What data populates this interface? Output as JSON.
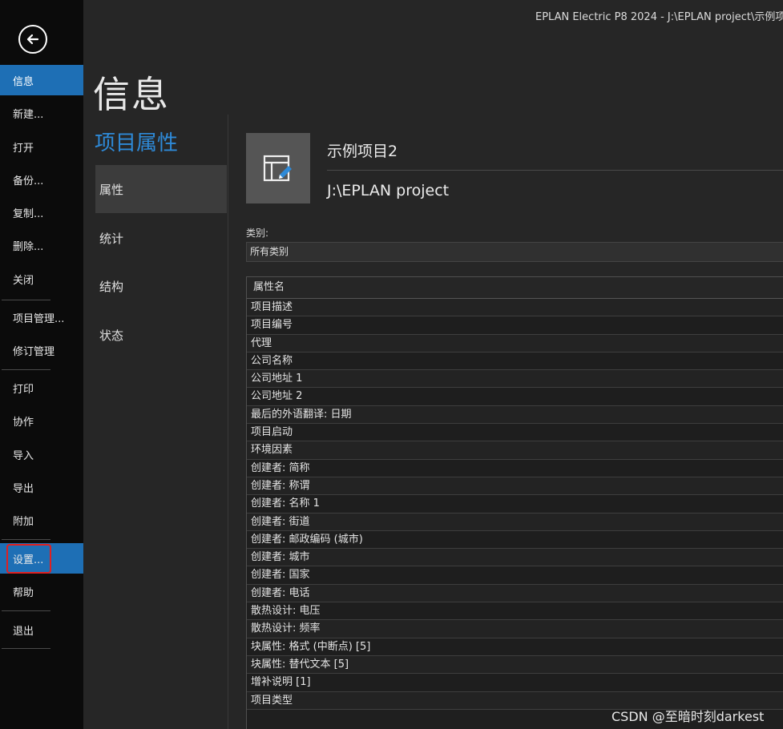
{
  "window": {
    "title": "EPLAN Electric P8 2024 - J:\\EPLAN project\\示例项"
  },
  "nav": {
    "back_icon": "arrow-left-circle-icon",
    "items": [
      {
        "label": "信息"
      },
      {
        "label": "新建..."
      },
      {
        "label": "打开"
      },
      {
        "label": "备份..."
      },
      {
        "label": "复制..."
      },
      {
        "label": "删除..."
      },
      {
        "label": "关闭"
      },
      {
        "label": "项目管理..."
      },
      {
        "label": "修订管理"
      },
      {
        "label": "打印"
      },
      {
        "label": "协作"
      },
      {
        "label": "导入"
      },
      {
        "label": "导出"
      },
      {
        "label": "附加"
      },
      {
        "label": "设置..."
      },
      {
        "label": "帮助"
      },
      {
        "label": "退出"
      }
    ]
  },
  "page": {
    "title": "信息"
  },
  "subnav": {
    "title": "项目属性",
    "items": [
      {
        "label": "属性"
      },
      {
        "label": "统计"
      },
      {
        "label": "结构"
      },
      {
        "label": "状态"
      }
    ]
  },
  "project": {
    "icon": "project-edit-icon",
    "name": "示例项目2",
    "path": "J:\\EPLAN project"
  },
  "category": {
    "label": "类别:",
    "value": "所有类别"
  },
  "properties": {
    "header": "属性名",
    "rows": [
      "项目描述",
      "项目编号",
      "代理",
      "公司名称",
      "公司地址 1",
      "公司地址 2",
      "最后的外语翻译: 日期",
      "项目启动",
      "环境因素",
      "创建者: 简称",
      "创建者: 称谓",
      "创建者: 名称 1",
      "创建者: 街道",
      "创建者: 邮政编码 (城市)",
      "创建者: 城市",
      "创建者: 国家",
      "创建者: 电话",
      "散热设计: 电压",
      "散热设计: 频率",
      "块属性: 格式 (中断点) [5]",
      "块属性: 替代文本 [5]",
      "增补说明 [1]",
      "项目类型"
    ]
  },
  "watermark": "CSDN @至暗时刻darkest",
  "colors": {
    "accent": "#1e6fb5",
    "subnav_title": "#2e8ad8",
    "highlight_box": "#e02020"
  }
}
